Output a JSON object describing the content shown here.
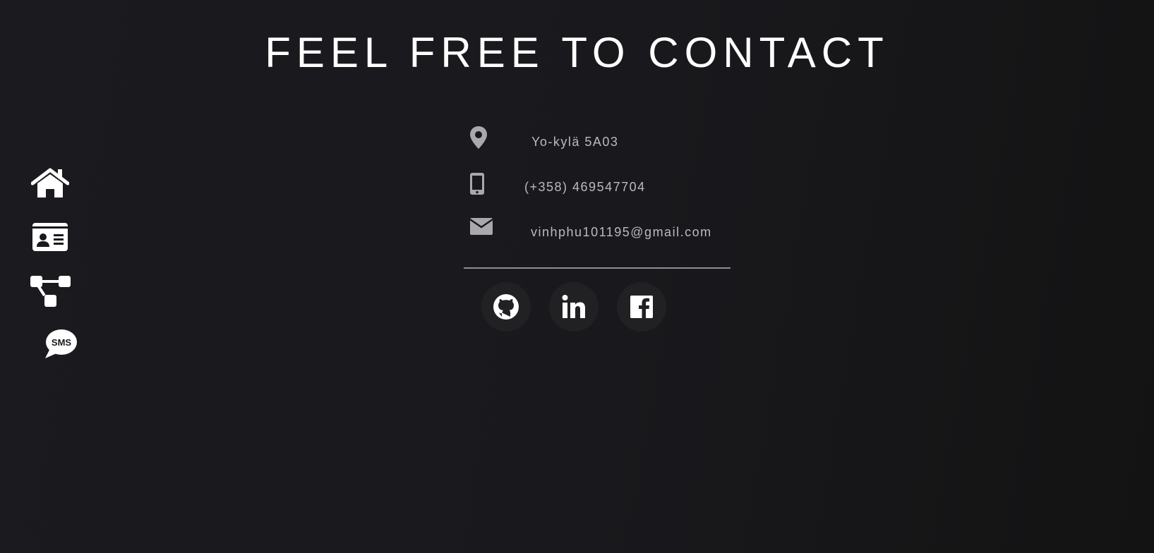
{
  "page": {
    "title": "FEEL FREE TO CONTACT"
  },
  "side_nav": {
    "items": [
      {
        "icon": "home-icon"
      },
      {
        "icon": "id-card-icon"
      },
      {
        "icon": "project-tree-icon"
      },
      {
        "icon": "sms-chat-icon",
        "glyph_text": "SMS"
      }
    ]
  },
  "contact": {
    "address": {
      "icon": "map-pin-icon",
      "text": "Yo-kylä 5A03"
    },
    "phone": {
      "icon": "mobile-phone-icon",
      "text": "(+358) 469547704"
    },
    "email": {
      "icon": "envelope-icon",
      "text": "vinhphu101195@gmail.com"
    }
  },
  "social": [
    {
      "icon": "github-icon"
    },
    {
      "icon": "linkedin-icon"
    },
    {
      "icon": "facebook-icon"
    }
  ],
  "colors": {
    "background": "#19191d",
    "title": "#ffffff",
    "contact_text": "#b9b9bf",
    "contact_icon": "#a9a9ad",
    "divider": "#8e8e92",
    "social_circle": "#212124"
  }
}
